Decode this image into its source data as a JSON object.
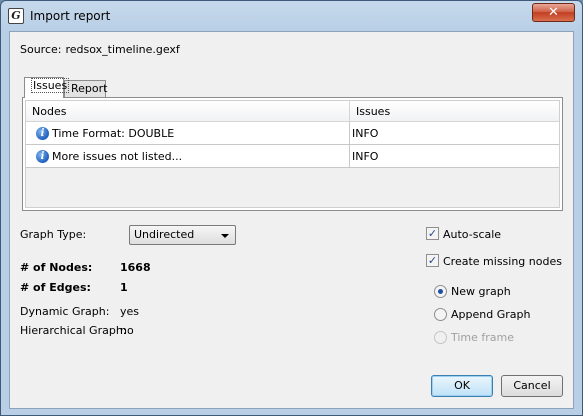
{
  "window": {
    "title": "Import report",
    "app_icon_glyph": "G",
    "close_glyph": "✕"
  },
  "source": {
    "label": "Source:",
    "value": "redsox_timeline.gexf"
  },
  "tabs": [
    {
      "label": "Issues",
      "active": true
    },
    {
      "label": "Report",
      "active": false
    }
  ],
  "issues_table": {
    "headers": [
      "Nodes",
      "Issues"
    ],
    "rows": [
      {
        "icon": "info-icon",
        "node": "Time Format: DOUBLE",
        "issue": "INFO"
      },
      {
        "icon": "info-icon",
        "node": "More issues not listed...",
        "issue": "INFO"
      }
    ]
  },
  "graph_type": {
    "label": "Graph Type:",
    "value": "Undirected"
  },
  "stats": {
    "nodes_label": "# of Nodes:",
    "nodes_value": "1668",
    "edges_label": "# of Edges:",
    "edges_value": "1",
    "dynamic_label": "Dynamic Graph:",
    "dynamic_value": "yes",
    "hierarchical_label": "Hierarchical Graph:",
    "hierarchical_value": "no"
  },
  "options": {
    "auto_scale": {
      "label": "Auto-scale",
      "checked": true
    },
    "create_missing_nodes": {
      "label": "Create missing nodes",
      "checked": true
    },
    "check_glyph": "✓"
  },
  "mode": {
    "new_graph": {
      "label": "New graph",
      "selected": true
    },
    "append_graph": {
      "label": "Append Graph",
      "selected": false
    },
    "time_frame": {
      "label": "Time frame",
      "selected": false,
      "disabled": true
    }
  },
  "buttons": {
    "ok": "OK",
    "cancel": "Cancel"
  }
}
